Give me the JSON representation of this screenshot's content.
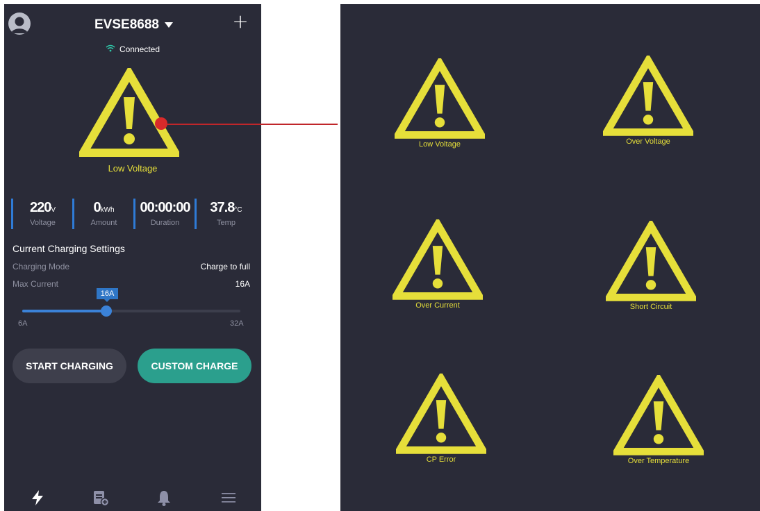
{
  "header": {
    "device_name": "EVSE8688",
    "connection_status": "Connected"
  },
  "status": {
    "alert_label": "Low Voltage"
  },
  "stats": [
    {
      "value": "220",
      "unit": "V",
      "label": "Voltage"
    },
    {
      "value": "0",
      "unit": "kWh",
      "label": "Amount"
    },
    {
      "value": "00:00:00",
      "unit": "",
      "label": "Duration"
    },
    {
      "value": "37.8",
      "unit": "°C",
      "label": "Temp"
    }
  ],
  "settings": {
    "title": "Current Charging Settings",
    "charging_mode_label": "Charging Mode",
    "charging_mode_value": "Charge to full",
    "max_current_label": "Max Current",
    "max_current_value": "16A",
    "slider": {
      "min": 6,
      "max": 32,
      "value": 16,
      "min_label": "6A",
      "max_label": "32A",
      "tooltip": "16A"
    }
  },
  "buttons": {
    "start_label": "START CHARGING",
    "custom_label": "CUSTOM CHARGE"
  },
  "tabs": [
    {
      "icon": "lightning-icon",
      "active": true
    },
    {
      "icon": "records-icon",
      "active": false
    },
    {
      "icon": "bell-icon",
      "active": false
    },
    {
      "icon": "menu-icon",
      "active": false
    }
  ],
  "warnings": [
    "Low Voltage",
    "Over Voltage",
    "Over Current",
    "Short Circuit",
    "CP Error",
    "Over Temperature"
  ],
  "colors": {
    "background": "#2a2b38",
    "warning": "#e6df3a",
    "accent_blue": "#3b82d8",
    "accent_teal": "#2b9f8d",
    "connector_red": "#c0262a"
  }
}
